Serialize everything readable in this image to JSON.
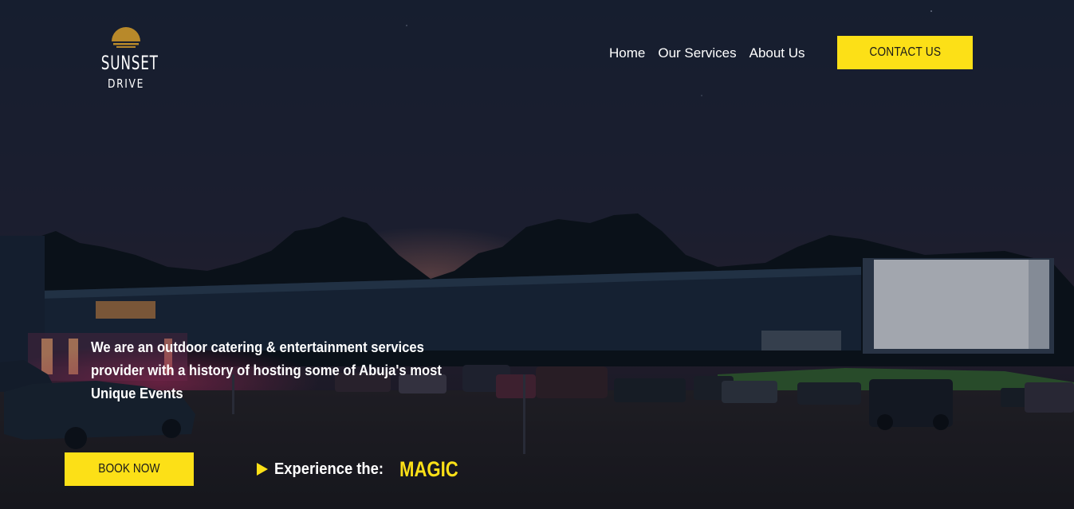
{
  "brand": {
    "line1": "SUNSET",
    "line2": "DRIVE",
    "sun_color": "#b8892a"
  },
  "nav": {
    "items": [
      {
        "label": "Home"
      },
      {
        "label": "Our Services"
      },
      {
        "label": "About Us"
      }
    ],
    "contact_label": "CONTACT US"
  },
  "hero": {
    "tagline_lines": [
      "We are an outdoor catering & entertainment services",
      "provider with a history of hosting some of Abuja's most",
      "Unique Events"
    ],
    "book_label": "BOOK NOW",
    "experience_label": "Experience the:",
    "magic_label": "MAGIC",
    "background_image": "night drive-in cinema with cars facing a lit outdoor screen"
  },
  "colors": {
    "accent": "#fce017",
    "text": "#ffffff",
    "sky_top": "#20283a",
    "sky_bottom": "#2c2238"
  }
}
